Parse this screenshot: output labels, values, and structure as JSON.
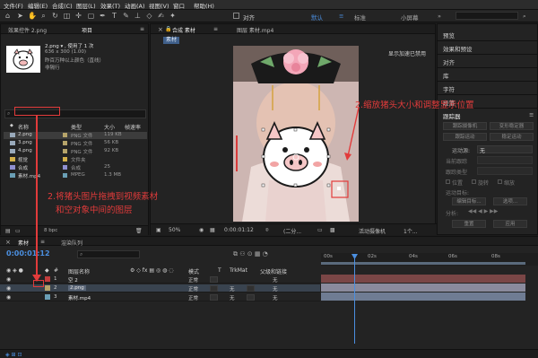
{
  "menubar": {
    "items": [
      "文件(F)",
      "编辑(E)",
      "合成(C)",
      "图层(L)",
      "效果(T)",
      "动画(A)",
      "视图(V)",
      "窗口",
      "帮助(H)"
    ]
  },
  "toolbar": {
    "snap_label": "对齐",
    "workspaces": [
      "默认",
      "标准",
      "小屏幕"
    ],
    "active_workspace": "默认"
  },
  "effects_tab": "效果控件 2.png",
  "project": {
    "tab": "项目",
    "selected_name": "2.png ▾ , 使用了 1 次",
    "selected_dims": "636 x 300 (1.00)",
    "selected_note1": "昨百万种以上颜色（直线）",
    "selected_note2": "非隔行",
    "columns": [
      "名称",
      "类型",
      "大小",
      "帧速率"
    ],
    "items": [
      {
        "name": "2.png",
        "type": "PNG 文件",
        "size": "119 KB",
        "color": "#b6a46a",
        "selected": true
      },
      {
        "name": "3.png",
        "type": "PNG 文件",
        "size": "56 KB",
        "color": "#b6a46a",
        "selected": false
      },
      {
        "name": "4.png",
        "type": "PNG 文件",
        "size": "92 KB",
        "color": "#b6a46a",
        "selected": false
      },
      {
        "name": "视觉",
        "type": "文件夹",
        "size": "",
        "color": "#d3b04a",
        "selected": false
      },
      {
        "name": "合成",
        "type": "合成",
        "size": "25",
        "color": "#8f8fd0",
        "selected": false
      },
      {
        "name": "素材.mp4",
        "type": "MPEG",
        "size": "1.3 MB",
        "color": "#6a9fb5",
        "selected": false
      }
    ],
    "bpc": "8 bpc"
  },
  "viewer": {
    "tabs": [
      "合成 素材",
      "图层 素材.mp4"
    ],
    "sub_tab": "素材",
    "notice": "显示加速已禁用",
    "zoom": "50%",
    "timecode": "0:00:01:12",
    "resolution": "(二分...",
    "camera": "活动摄像机",
    "views": "1个..."
  },
  "right_panels": {
    "items": [
      "预览",
      "效果和预设",
      "对齐",
      "库",
      "字符",
      "段落"
    ],
    "tracker": {
      "title": "跟踪器",
      "buttons": [
        "跟踪摄像机",
        "变形稳定器",
        "跟踪运动",
        "稳定运动"
      ],
      "motion_source_label": "运动源:",
      "motion_source_value": "无",
      "current_track_label": "当前跟踪",
      "track_type_label": "跟踪类型",
      "position": "位置",
      "rotation": "旋转",
      "scale": "缩放",
      "motion_target": "运动目标:",
      "edit_target": "编辑目标...",
      "options": "选项...",
      "analyze": "分析:",
      "reset": "重置",
      "apply": "应用"
    }
  },
  "timeline": {
    "tabs": [
      "素材",
      "渲染队列"
    ],
    "timecode": "0:00:01:12",
    "columns": [
      "图层名称",
      "模式",
      "T",
      "TrkMat",
      "父级和链接"
    ],
    "layers": [
      {
        "num": "1",
        "name": "空 2",
        "mode": "正常",
        "trkmat": "",
        "parent": "无",
        "color": "#c23c3c",
        "bar": "#7a4646"
      },
      {
        "num": "2",
        "name": "2.png",
        "mode": "正常",
        "trkmat": "无",
        "parent": "无",
        "color": "#b6a46a",
        "bar": "#8a8a9c"
      },
      {
        "num": "3",
        "name": "素材.mp4",
        "mode": "正常",
        "trkmat": "无",
        "parent": "无",
        "color": "#6a9fb5",
        "bar": "#6f7c93"
      }
    ],
    "ruler_ticks": [
      "00s",
      "02s",
      "04s",
      "06s",
      "08s"
    ]
  },
  "annotations": {
    "left_line1": "2.将猪头图片拖拽到视频素材",
    "left_line2": "和空对象中间的图层",
    "right": "2.缩放猪头大小和调整显示位置"
  },
  "colors": {
    "accent": "#4b8fe0",
    "annotation": "#e23b3b"
  }
}
